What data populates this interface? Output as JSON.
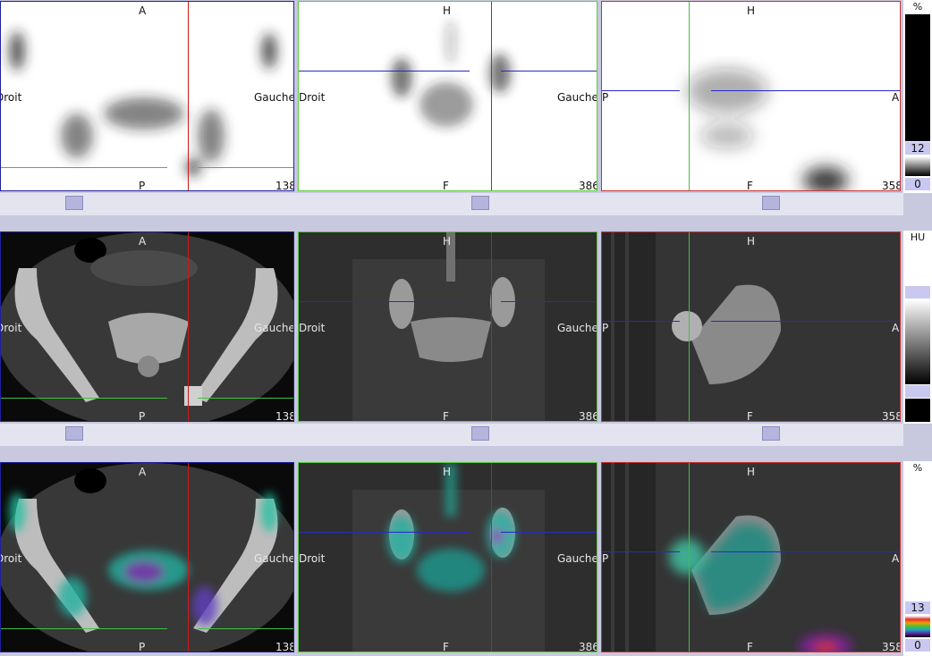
{
  "orientation": {
    "anterior": "A",
    "posterior": "P",
    "head": "H",
    "feet": "F",
    "patient_right": "Droit",
    "patient_left": "Gauche"
  },
  "slices": {
    "axial": "138",
    "coronal": "386",
    "sagittal": "358"
  },
  "scales": {
    "nm": {
      "unit": "%",
      "max": "12",
      "min": "0"
    },
    "ct": {
      "unit": "HU"
    },
    "fusion": {
      "unit": "%",
      "max": "13",
      "min": "0"
    }
  },
  "colors": {
    "axial_border": "#2020a0",
    "coronal_border": "#5ccc3c",
    "sagittal_border": "#c83232",
    "crosshair_red": "#d01818",
    "crosshair_green": "#40c040",
    "crosshair_blue": "#2828c8"
  }
}
